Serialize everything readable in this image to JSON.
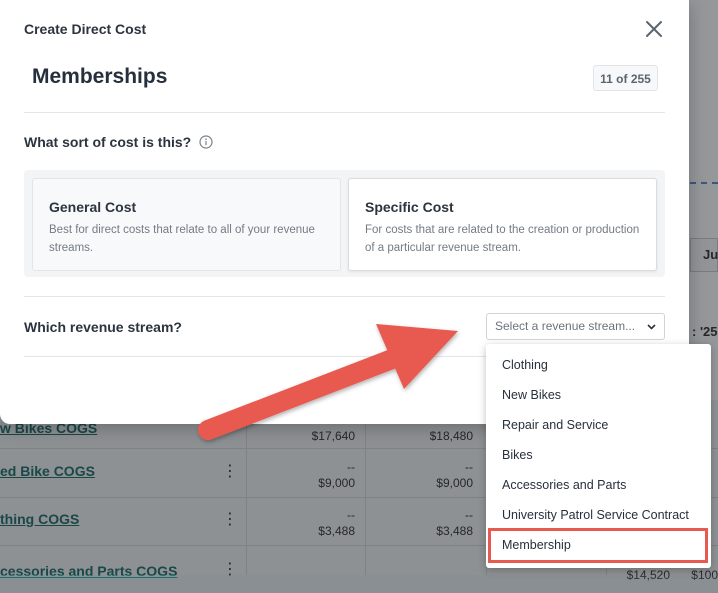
{
  "background": {
    "rows": [
      {
        "name": "w Bikes COGS",
        "cells": [
          {
            "top": "",
            "bottom": "$17,640"
          },
          {
            "top": "",
            "bottom": "$18,480"
          }
        ]
      },
      {
        "name": "ed Bike COGS",
        "cells": [
          {
            "top": "--",
            "bottom": "$9,000"
          },
          {
            "top": "--",
            "bottom": "$9,000"
          }
        ]
      },
      {
        "name": "thing COGS",
        "cells": [
          {
            "top": "--",
            "bottom": "$3,488"
          },
          {
            "top": "--",
            "bottom": "$3,488"
          }
        ]
      },
      {
        "name": "cessories and Parts COGS",
        "cells": [
          {
            "top": "",
            "bottom": ""
          },
          {
            "top": "",
            "bottom": ""
          }
        ]
      }
    ],
    "right_tab": "Ju",
    "right_header": ": '25",
    "partial_values": [
      "$14,520",
      "$100"
    ]
  },
  "modal": {
    "title": "Create Direct Cost",
    "page_title": "Memberships",
    "counter": "11 of 255",
    "question": "What sort of cost is this?",
    "general": {
      "title": "General Cost",
      "desc": "Best for direct costs that relate to all of your revenue streams."
    },
    "specific": {
      "title": "Specific Cost",
      "desc": "For costs that are related to the creation or production of a particular revenue stream."
    },
    "stream_label": "Which revenue stream?",
    "select_placeholder": "Select a revenue stream..."
  },
  "dropdown": {
    "options": [
      "Clothing",
      "New Bikes",
      "Repair and Service",
      "Bikes",
      "Accessories and Parts",
      "University Patrol Service Contract",
      "Membership"
    ],
    "highlighted": "Membership"
  },
  "colors": {
    "annotation": "#e85a4f",
    "link": "#1f6e6a"
  },
  "icons": {
    "close": "close-icon",
    "info": "info-icon",
    "chevron": "chevron-down-icon"
  }
}
